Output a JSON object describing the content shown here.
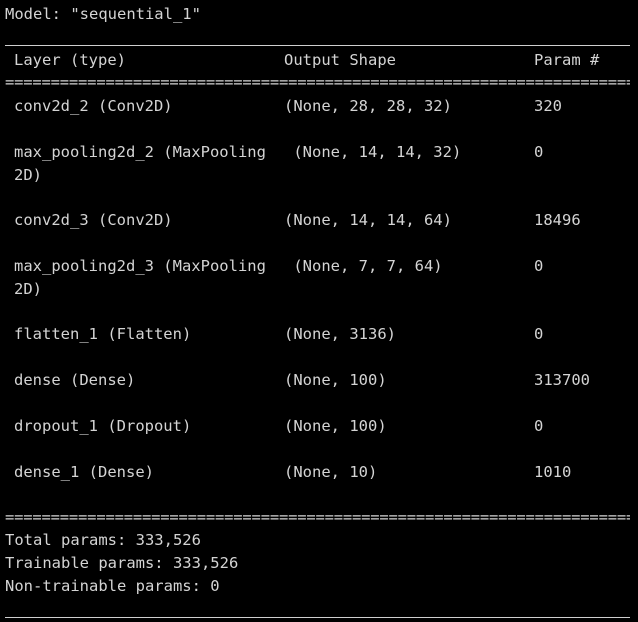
{
  "model_line": "Model: \"sequential_1\"",
  "header": {
    "layer": "Layer (type)",
    "output_shape": "Output Shape",
    "params": "Param #"
  },
  "double_rule": "===================================================================================",
  "layers": [
    {
      "name": "conv2d_2 (Conv2D)",
      "name2": "",
      "shape": "(None, 28, 28, 32)",
      "params": "320"
    },
    {
      "name": "max_pooling2d_2 (MaxPooling",
      "name2": "2D)",
      "shape": " (None, 14, 14, 32)",
      "params": "0"
    },
    {
      "name": "conv2d_3 (Conv2D)",
      "name2": "",
      "shape": "(None, 14, 14, 64)",
      "params": "18496"
    },
    {
      "name": "max_pooling2d_3 (MaxPooling",
      "name2": "2D)",
      "shape": " (None, 7, 7, 64)",
      "params": "0"
    },
    {
      "name": "flatten_1 (Flatten)",
      "name2": "",
      "shape": "(None, 3136)",
      "params": "0"
    },
    {
      "name": "dense (Dense)",
      "name2": "",
      "shape": "(None, 100)",
      "params": "313700"
    },
    {
      "name": "dropout_1 (Dropout)",
      "name2": "",
      "shape": "(None, 100)",
      "params": "0"
    },
    {
      "name": "dense_1 (Dense)",
      "name2": "",
      "shape": "(None, 10)",
      "params": "1010"
    }
  ],
  "summary": {
    "total": "Total params: 333,526",
    "trainable": "Trainable params: 333,526",
    "non_trainable": "Non-trainable params: 0"
  }
}
